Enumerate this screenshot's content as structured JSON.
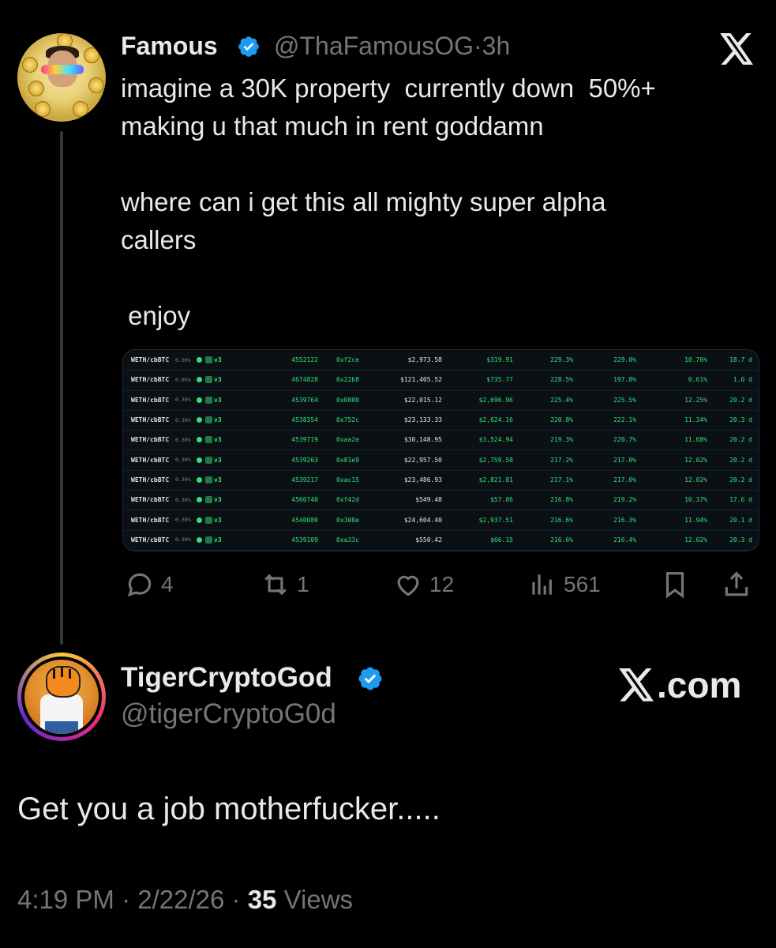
{
  "tweet": {
    "author_name": "Famous",
    "author_handle": "@ThaFamousOG",
    "separator": "·",
    "time_ago": "3h",
    "text": "imagine a 30K property  currently down  50%+\nmaking u that much in rent goddamn\n\nwhere can i get this all mighty super alpha\ncallers\n\n enjoy",
    "actions": {
      "replies": "4",
      "reposts": "1",
      "likes": "12",
      "views": "561"
    },
    "image_rows": [
      {
        "pair": "WETH/cbBTC",
        "fee": "0.30%",
        "ver": "v3",
        "id": "4552122",
        "addr": "0xf2ce",
        "v1": "$2,973.58",
        "v2": "$319.91",
        "p1": "229.3%",
        "p2": "229.0%",
        "p3": "10.76%",
        "d": "18.7 d"
      },
      {
        "pair": "WETH/cbBTC",
        "fee": "0.05%",
        "ver": "v3",
        "id": "4674828",
        "addr": "0x22b8",
        "v1": "$121,405.52",
        "v2": "$735.77",
        "p1": "228.5%",
        "p2": "197.8%",
        "p3": "0.61%",
        "d": "1.0 d"
      },
      {
        "pair": "WETH/cbBTC",
        "fee": "0.30%",
        "ver": "v3",
        "id": "4539764",
        "addr": "0x0800",
        "v1": "$22,015.12",
        "v2": "$2,696.96",
        "p1": "225.4%",
        "p2": "225.5%",
        "p3": "12.25%",
        "d": "20.2 d"
      },
      {
        "pair": "WETH/cbBTC",
        "fee": "0.30%",
        "ver": "v3",
        "id": "4538354",
        "addr": "0x752c",
        "v1": "$23,133.33",
        "v2": "$2,624.16",
        "p1": "220.8%",
        "p2": "222.1%",
        "p3": "11.34%",
        "d": "20.3 d"
      },
      {
        "pair": "WETH/cbBTC",
        "fee": "0.30%",
        "ver": "v3",
        "id": "4539719",
        "addr": "0xaa2e",
        "v1": "$30,148.95",
        "v2": "$3,524.94",
        "p1": "219.3%",
        "p2": "220.7%",
        "p3": "11.68%",
        "d": "20.2 d"
      },
      {
        "pair": "WETH/cbBTC",
        "fee": "0.30%",
        "ver": "v3",
        "id": "4539263",
        "addr": "0x81e9",
        "v1": "$22,957.50",
        "v2": "$2,759.58",
        "p1": "217.2%",
        "p2": "217.0%",
        "p3": "12.02%",
        "d": "20.2 d"
      },
      {
        "pair": "WETH/cbBTC",
        "fee": "0.30%",
        "ver": "v3",
        "id": "4539217",
        "addr": "0xac15",
        "v1": "$23,486.93",
        "v2": "$2,821.81",
        "p1": "217.1%",
        "p2": "217.0%",
        "p3": "12.02%",
        "d": "20.2 d"
      },
      {
        "pair": "WETH/cbBTC",
        "fee": "0.30%",
        "ver": "v3",
        "id": "4560740",
        "addr": "0xf42d",
        "v1": "$549.48",
        "v2": "$57.06",
        "p1": "216.8%",
        "p2": "219.2%",
        "p3": "10.37%",
        "d": "17.6 d"
      },
      {
        "pair": "WETH/cbBTC",
        "fee": "0.30%",
        "ver": "v3",
        "id": "4540080",
        "addr": "0x308e",
        "v1": "$24,604.40",
        "v2": "$2,937.51",
        "p1": "216.6%",
        "p2": "216.3%",
        "p3": "11.94%",
        "d": "20.1 d"
      },
      {
        "pair": "WETH/cbBTC",
        "fee": "0.30%",
        "ver": "v3",
        "id": "4539109",
        "addr": "0xa33c",
        "v1": "$550.42",
        "v2": "$66.15",
        "p1": "216.6%",
        "p2": "216.4%",
        "p3": "12.02%",
        "d": "20.3 d"
      }
    ]
  },
  "reply": {
    "author_name": "TigerCryptoGod",
    "author_handle": "@tigerCryptoG0d",
    "brand": ".com",
    "text": "Get you a job motherfucker.....",
    "time": "4:19 PM",
    "separator": "·",
    "date": "2/22/26",
    "views_count": "35",
    "views_label": "Views"
  },
  "colors": {
    "background": "#000000",
    "text": "#e7e9ea",
    "secondary": "#71767b",
    "verified": "#1d9bf0",
    "green": "#2ee27b"
  },
  "icons": [
    "verified-badge-icon",
    "x-logo-icon",
    "reply-icon",
    "repost-icon",
    "like-icon",
    "views-icon",
    "bookmark-icon",
    "share-icon"
  ]
}
